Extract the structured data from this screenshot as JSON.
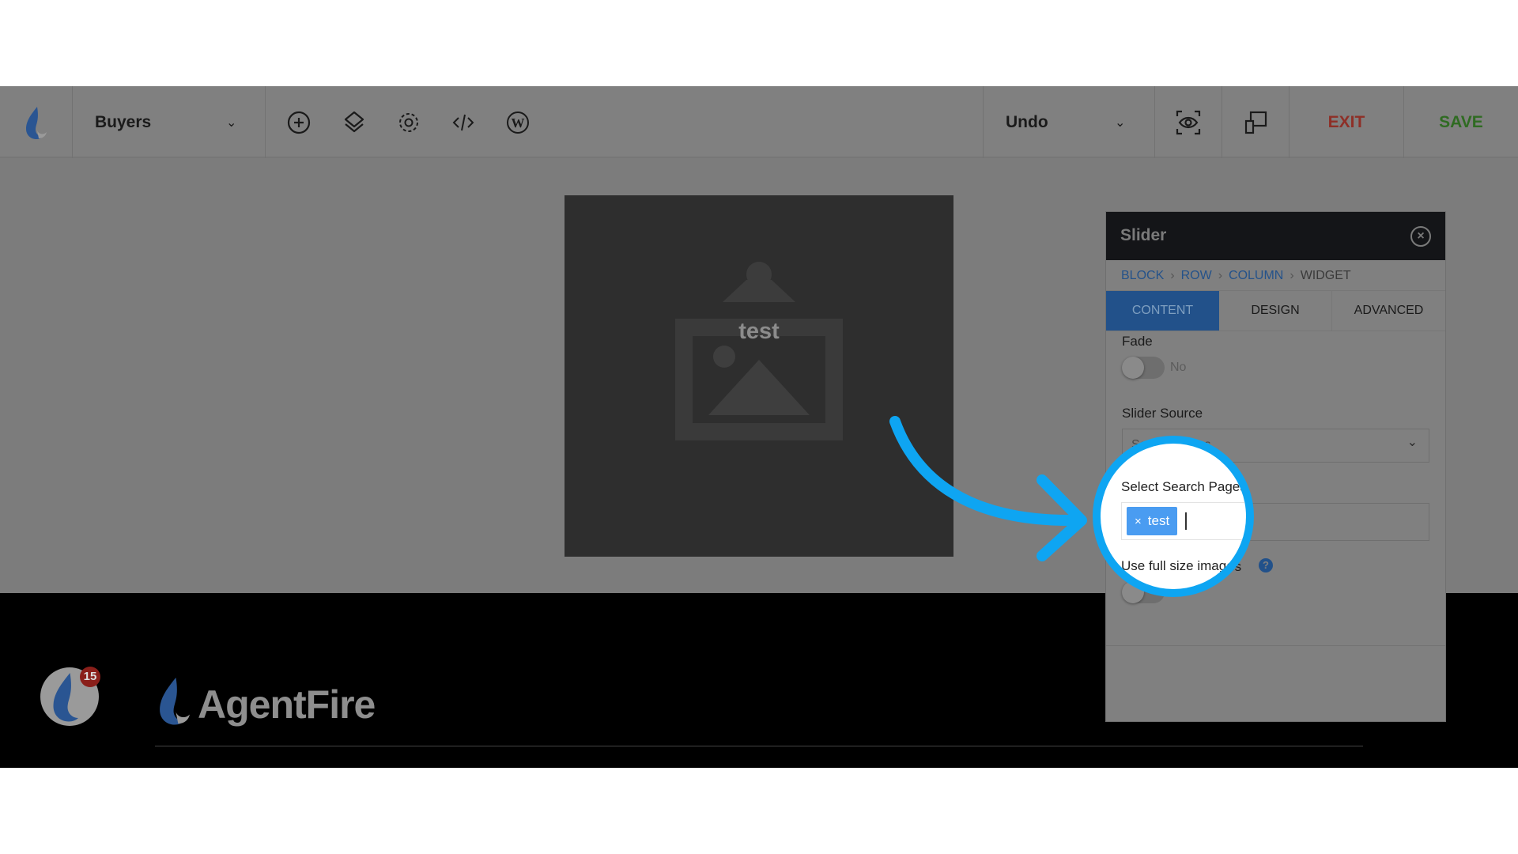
{
  "toolbar": {
    "page_select": "Buyers",
    "icons": [
      "add-icon",
      "layers-icon",
      "settings-icon",
      "code-icon",
      "wordpress-icon"
    ],
    "undo_label": "Undo",
    "exit_label": "EXIT",
    "save_label": "SAVE",
    "colors": {
      "exit": "#8e2f27",
      "save": "#2f6b22"
    }
  },
  "canvas": {
    "image_caption": "test"
  },
  "footer": {
    "notification_count": "15",
    "logo_text": "AgentFire"
  },
  "panel": {
    "title": "Slider",
    "breadcrumb": [
      "BLOCK",
      "ROW",
      "COLUMN",
      "WIDGET"
    ],
    "tabs": [
      "CONTENT",
      "DESIGN",
      "ADVANCED"
    ],
    "active_tab": "CONTENT",
    "fade": {
      "label": "Fade",
      "value": "No"
    },
    "slider_source": {
      "label": "Slider Source",
      "value": "Search Pages"
    },
    "select_pages": {
      "label": "Select Search Pages",
      "tags": [
        "test"
      ],
      "tag_remove": "×"
    },
    "full_size": {
      "label": "Use full size images",
      "value": "No",
      "help": "?"
    }
  },
  "highlight_color": "#0ea5f2"
}
